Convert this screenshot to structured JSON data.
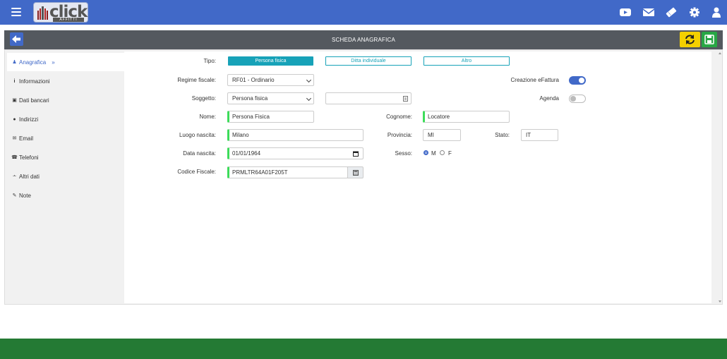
{
  "app": {
    "logo_word": "click",
    "logo_sub": "AFFITTI",
    "title": "SCHEDA ANAGRAFICA"
  },
  "colors": {
    "topbar": "#4169c8",
    "titlebar": "#54595f",
    "accent": "#17a2b8",
    "required_marker": "#3ddc5a",
    "refresh_button": "#f4d000",
    "save_button": "#28a745",
    "footer": "#247a34"
  },
  "topbar_icons": [
    "youtube-icon",
    "mail-icon",
    "ticket-icon",
    "gear-icon",
    "user-icon"
  ],
  "sidebar": {
    "active": {
      "label": "Anagrafica",
      "suffix": "»",
      "icon": "user-icon"
    },
    "items": [
      {
        "label": "Informazioni",
        "icon": "info-icon"
      },
      {
        "label": "Dati bancari",
        "icon": "money-icon"
      },
      {
        "label": "Indirizzi",
        "icon": "map-marker-icon"
      },
      {
        "label": "Email",
        "icon": "envelope-icon"
      },
      {
        "label": "Telefoni",
        "icon": "phone-icon"
      },
      {
        "label": "Altri dati",
        "icon": "paperclip-icon"
      },
      {
        "label": "Note",
        "icon": "edit-icon"
      }
    ]
  },
  "form": {
    "tipo": {
      "label": "Tipo:",
      "options": [
        "Persona fisica",
        "Ditta individuale",
        "Altro"
      ],
      "selected": "Persona fisica"
    },
    "regime_fiscale": {
      "label": "Regime fiscale:",
      "value": "RF01 - Ordinario"
    },
    "soggetto": {
      "label": "Soggetto:",
      "value": "Persona fisica",
      "extra_value": ""
    },
    "nome": {
      "label": "Nome:",
      "value": "Persona Fisica"
    },
    "cognome": {
      "label": "Cognome:",
      "value": "Locatore"
    },
    "luogo_nascita": {
      "label": "Luogo nascita:",
      "value": "Milano"
    },
    "provincia": {
      "label": "Provincia:",
      "value": "MI"
    },
    "stato": {
      "label": "Stato:",
      "value": "IT"
    },
    "data_nascita": {
      "label": "Data nascita:",
      "value": "01/01/1964"
    },
    "sesso": {
      "label": "Sesso:",
      "options": [
        "M",
        "F"
      ],
      "selected": "M"
    },
    "codice_fiscale": {
      "label": "Codice Fiscale:",
      "value": "PRMLTR64A01F205T"
    },
    "creazione_efattura": {
      "label": "Creazione eFattura",
      "on": true
    },
    "agenda": {
      "label": "Agenda",
      "on": false
    }
  }
}
